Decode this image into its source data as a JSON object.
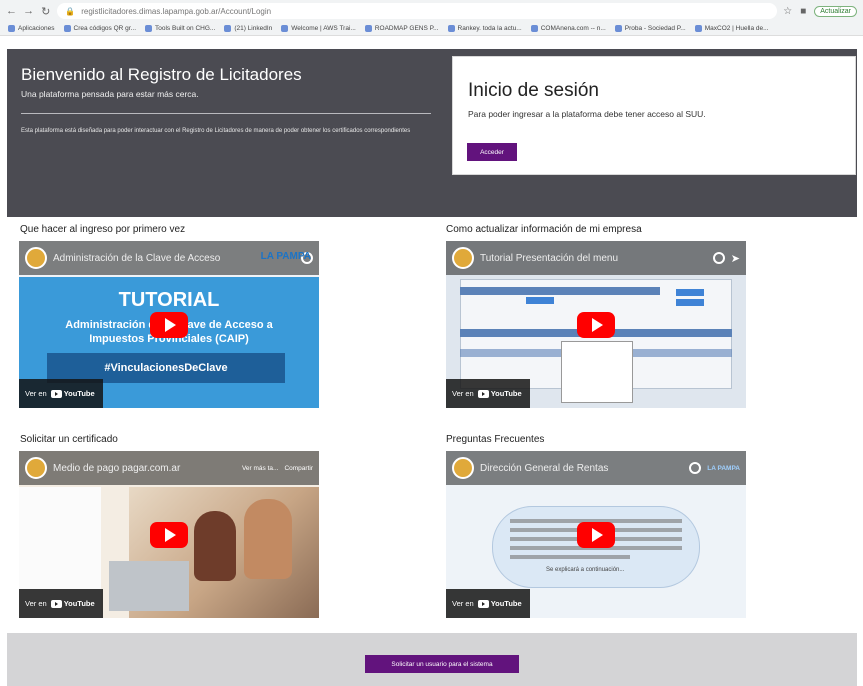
{
  "browser": {
    "url": "registlicitadores.dimas.lapampa.gob.ar/Account/Login",
    "update_label": "Actualizar",
    "bookmarks": [
      "Aplicaciones",
      "Crea códigos QR gr...",
      "Tools Built on CHG...",
      "(21) LinkedIn",
      "Welcome | AWS Trai...",
      "ROADMAP GENS P...",
      "Rankey. toda la actu...",
      "COMAnena.com -- n...",
      "Proba - Sociedad P...",
      "MaxCO2 | Huella de..."
    ]
  },
  "hero": {
    "title": "Bienvenido al Registro de Licitadores",
    "subtitle": "Una plataforma pensada para estar más cerca.",
    "description": "Esta plataforma está diseñada para poder interactuar con el Registro de Licitadores de manera de poder obtener los certificados correspondientes"
  },
  "login": {
    "title": "Inicio de sesión",
    "text": "Para poder ingresar a la plataforma debe tener acceso al SUU.",
    "button": "Acceder"
  },
  "colors": {
    "hero_bg": "#4b4b52",
    "accent": "#62137d",
    "footer_bg": "#d4d4d6"
  },
  "sections": [
    {
      "title": "Que hacer al ingreso por primero vez",
      "video_title": "Administración de la Clave de Acceso",
      "brand": "LA PAMPA",
      "tutorial": "TUTORIAL",
      "lines": [
        "Administración de la Clave de Acceso a",
        "Impuestos Provinciales (CAIP)"
      ],
      "banner": "#VinculacionesDeClave"
    },
    {
      "title": "Como actualizar información de mi empresa",
      "video_title": "Tutorial Presentación del menu"
    },
    {
      "title": "Solicitar un certificado",
      "video_title": "Medio de pago pagar.com.ar",
      "watch_later": "Ver más ta...",
      "share": "Compartir"
    },
    {
      "title": "Preguntas Frecuentes",
      "video_title": "Dirección General de Rentas",
      "brand": "LA PAMPA",
      "note": "Se explicará a continuación..."
    }
  ],
  "video_common": {
    "watch_on": "Ver en",
    "youtube": "YouTube"
  },
  "footer": {
    "button": "Solicitar un usuario para el sistema"
  }
}
